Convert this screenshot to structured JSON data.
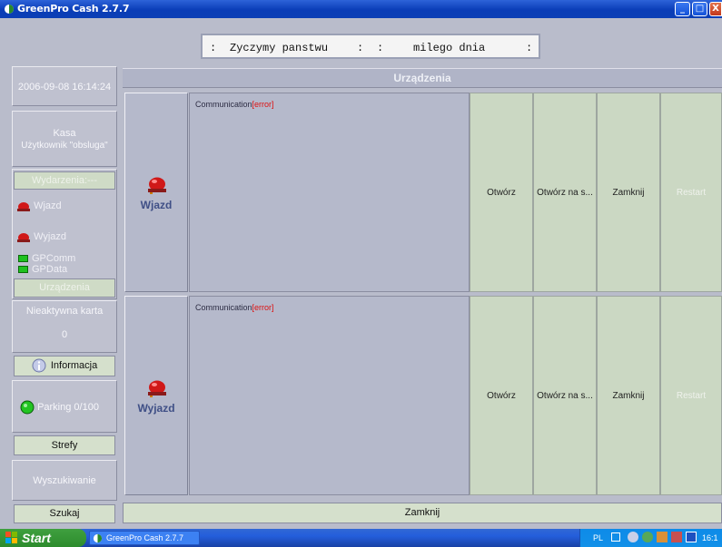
{
  "window": {
    "title": "GreenPro Cash 2.7.7",
    "minimize_glyph": "_",
    "maximize_glyph": "□",
    "close_glyph": "X"
  },
  "message_bar": {
    "colon1": ":",
    "text1": "Zyczymy panstwu",
    "colon2": ":",
    "colon3": ":",
    "text2": "milego dnia",
    "colon4": ":"
  },
  "left_panel": {
    "datetime": "2006-09-08 16:14:24",
    "kasa_label": "Kasa",
    "user_label": "Użytkownik \"obsluga\"",
    "events_button": "Wydarzenia:---",
    "events": [
      {
        "icon": "alarm-light-icon",
        "label": "Wjazd"
      },
      {
        "icon": "alarm-light-icon",
        "label": "Wyjazd"
      }
    ],
    "status_items": [
      {
        "label": "GPComm",
        "color": "#1fc11f"
      },
      {
        "label": "GPData",
        "color": "#1fc11f"
      }
    ],
    "devices_button": "Urządzenia",
    "inactive_card_label": "Nieaktywna karta",
    "inactive_card_count": "0",
    "info_button": "Informacja",
    "parking_label": "Parking 0/100",
    "zones_button": "Strefy",
    "search_label": "Wyszukiwanie",
    "search_button": "Szukaj"
  },
  "devices_header": "Urządzenia",
  "devices": [
    {
      "name": "Wjazd",
      "comm_prefix": "Communication",
      "comm_status": "[error]",
      "actions": [
        {
          "label": "Otwórz",
          "enabled": true
        },
        {
          "label": "Otwórz na s...",
          "enabled": true
        },
        {
          "label": "Zamknij",
          "enabled": true
        },
        {
          "label": "Restart",
          "enabled": false
        }
      ]
    },
    {
      "name": "Wyjazd",
      "comm_prefix": "Communication",
      "comm_status": "[error]",
      "actions": [
        {
          "label": "Otwórz",
          "enabled": true
        },
        {
          "label": "Otwórz na s...",
          "enabled": true
        },
        {
          "label": "Zamknij",
          "enabled": true
        },
        {
          "label": "Restart",
          "enabled": false
        }
      ]
    }
  ],
  "close_button": "Zamknij",
  "taskbar": {
    "start_label": "Start",
    "task_item": "GreenPro Cash 2.7.7",
    "tray_lang": "PL",
    "tray_time": "16:1"
  },
  "colors": {
    "accent_green": "#d5e0cc",
    "error_red": "#dd1111",
    "device_name_blue": "#3f4f86",
    "status_led_green": "#1fc11f"
  }
}
